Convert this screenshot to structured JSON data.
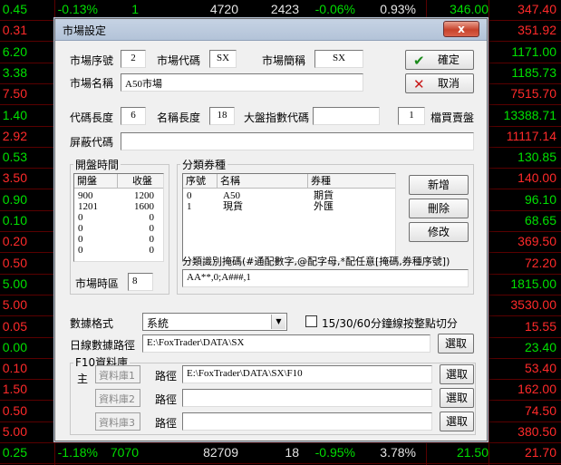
{
  "background_table": {
    "rows": [
      [
        "0.45",
        "-0.13%",
        "1",
        "4720",
        "2423",
        "-0.06%",
        "0.93%",
        "346.00",
        "347.40"
      ],
      [
        "0.31",
        "",
        "",
        "",
        "",
        "",
        "",
        "",
        "351.92"
      ],
      [
        "6.20",
        "",
        "",
        "",
        "",
        "",
        "",
        "",
        "1171.00"
      ],
      [
        "3.38",
        "",
        "",
        "",
        "",
        "",
        "",
        "",
        "1185.73"
      ],
      [
        "7.50",
        "",
        "",
        "",
        "",
        "",
        "",
        "",
        "7515.70"
      ],
      [
        "1.40",
        "",
        "",
        "",
        "",
        "",
        "",
        "",
        "13388.71"
      ],
      [
        "2.92",
        "",
        "",
        "",
        "",
        "",
        "",
        "",
        "11117.14"
      ],
      [
        "0.53",
        "",
        "",
        "",
        "",
        "",
        "",
        "",
        "130.85"
      ],
      [
        "3.50",
        "",
        "",
        "",
        "",
        "",
        "",
        "",
        "140.00"
      ],
      [
        "0.90",
        "",
        "",
        "",
        "",
        "",
        "",
        "",
        "96.10"
      ],
      [
        "0.10",
        "",
        "",
        "",
        "",
        "",
        "",
        "",
        "68.65"
      ],
      [
        "0.20",
        "",
        "",
        "",
        "",
        "",
        "",
        "",
        "369.50"
      ],
      [
        "0.50",
        "",
        "",
        "",
        "",
        "",
        "",
        "",
        "72.20"
      ],
      [
        "5.00",
        "",
        "",
        "",
        "",
        "",
        "",
        "",
        "1815.00"
      ],
      [
        "5.00",
        "",
        "",
        "",
        "",
        "",
        "",
        "",
        "3530.00"
      ],
      [
        "0.05",
        "",
        "",
        "",
        "",
        "",
        "",
        "",
        "15.55"
      ],
      [
        "0.00",
        "",
        "",
        "",
        "",
        "",
        "",
        "",
        "23.40"
      ],
      [
        "0.10",
        "",
        "",
        "",
        "",
        "",
        "",
        "",
        "53.40"
      ],
      [
        "1.50",
        "",
        "",
        "",
        "",
        "",
        "",
        "",
        "162.00"
      ],
      [
        "0.50",
        "",
        "",
        "",
        "",
        "",
        "",
        "",
        "74.50"
      ],
      [
        "5.00",
        "",
        "",
        "",
        "",
        "",
        "",
        "",
        "380.50"
      ],
      [
        "0.25",
        "-1.18%",
        "7070",
        "82709",
        "18",
        "-0.95%",
        "3.78%",
        "21.50",
        "21.70"
      ]
    ],
    "row_colors": [
      "green",
      "red",
      "green",
      "green",
      "red",
      "green",
      "red",
      "green",
      "red",
      "green",
      "green",
      "red",
      "red",
      "green",
      "red",
      "red",
      "green",
      "red",
      "red",
      "red",
      "red",
      "green"
    ],
    "colors": {
      "green": "#00e000",
      "red": "#ff2a2a",
      "white": "#e8e8e8",
      "grid": "#5a0000"
    }
  },
  "dialog": {
    "title": "市場設定",
    "close_glyph": "x",
    "market_no_label": "市場序號",
    "market_no": "2",
    "market_code_label": "市場代碼",
    "market_code": "SX",
    "market_short_label": "市場簡稱",
    "market_short": "SX",
    "market_name_label": "市場名稱",
    "market_name": "A50市場",
    "ok_label": "確定",
    "cancel_label": "取消",
    "code_len_label": "代碼長度",
    "code_len": "6",
    "name_len_label": "名稱長度",
    "name_len": "18",
    "index_code_label": "大盤指數代碼",
    "index_code": "",
    "file_value": "1",
    "file_label": "檔買賣盤",
    "mask_code_label": "屏蔽代碼",
    "mask_code": "",
    "open_time": {
      "group_label": "開盤時間",
      "col_open": "開盤",
      "col_close": "收盤",
      "rows": [
        [
          "900",
          "1200"
        ],
        [
          "1201",
          "1600"
        ],
        [
          "0",
          "0"
        ],
        [
          "0",
          "0"
        ],
        [
          "0",
          "0"
        ],
        [
          "0",
          "0"
        ]
      ],
      "timezone_label": "市場時區",
      "timezone": "8"
    },
    "category": {
      "group_label": "分類券種",
      "col_no": "序號",
      "col_name": "名稱",
      "col_type": "券種",
      "rows": [
        [
          "0",
          "A50",
          "期貨"
        ],
        [
          "1",
          "現貨",
          "外匯"
        ]
      ],
      "add_label": "新增",
      "delete_label": "刪除",
      "edit_label": "修改",
      "mask_label": "分類識別掩碼(#通配數字,@配字母,*配任意[掩碼,券種序號])",
      "mask_value": "AA**,0;A###,1"
    },
    "data_format_label": "數據格式",
    "data_format": "系統",
    "checkbox_label": "15/30/60分鐘線按整點切分",
    "daily_path_label": "日線數據路徑",
    "daily_path": "E:\\FoxTrader\\DATA\\SX",
    "browse_label": "選取",
    "f10": {
      "group_label": "F10資料庫",
      "main_label": "主",
      "path_label": "路徑",
      "libs": [
        {
          "name": "資料庫1",
          "path": "E:\\FoxTrader\\DATA\\SX\\F10"
        },
        {
          "name": "資料庫2",
          "path": ""
        },
        {
          "name": "資料庫3",
          "path": ""
        }
      ]
    }
  }
}
